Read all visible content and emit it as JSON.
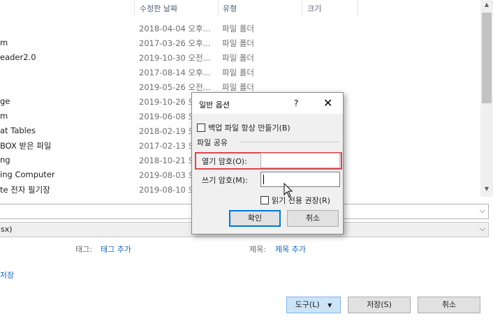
{
  "columns": {
    "date": "수정한 날짜",
    "type": "유형",
    "size": "크기"
  },
  "files": [
    {
      "name": "",
      "date": "2018-04-04 오후...",
      "type": "파일 폴더"
    },
    {
      "name": "m",
      "date": "2017-03-26 오후...",
      "type": "파일 폴더"
    },
    {
      "name": "eader2.0",
      "date": "2019-10-30 오전...",
      "type": "파일 폴더"
    },
    {
      "name": "",
      "date": "2017-08-14 오후...",
      "type": "파일 폴더"
    },
    {
      "name": "",
      "date": "2019-05-26 오전...",
      "type": "파일 폴더"
    },
    {
      "name": "ge",
      "date": "2019-10-26 오...",
      "type": ""
    },
    {
      "name": "m",
      "date": "2019-06-08 오...",
      "type": ""
    },
    {
      "name": "at Tables",
      "date": "2018-02-19 오...",
      "type": ""
    },
    {
      "name": "BOX 받은 파일",
      "date": "2017-02-13 오...",
      "type": ""
    },
    {
      "name": "ng",
      "date": "2018-10-21 오...",
      "type": ""
    },
    {
      "name": "ing Computer",
      "date": "2019-08-03 오...",
      "type": ""
    },
    {
      "name": "te 전자 필기장",
      "date": "2019-08-10 오...",
      "type": ""
    }
  ],
  "filename_field": {
    "value": ""
  },
  "filetype_field": {
    "value": "sx)"
  },
  "meta": {
    "tags_label": "태그:",
    "tags_link": "태그 추가",
    "title_label": "제목:",
    "title_link": "제목 추가"
  },
  "left_link": "저장",
  "buttons": {
    "tools": "도구(L)",
    "save": "저장(S)",
    "cancel": "취소"
  },
  "dialog": {
    "title": "일반 옵션",
    "help": "?",
    "close": "✕",
    "backup_label": "백업 파일 항상 만들기(B)",
    "backup_checked": false,
    "group_title": "파일 공유",
    "open_pw_label": "열기 암호(O):",
    "open_pw_value": "",
    "write_pw_label": "쓰기 암호(M):",
    "write_pw_value": "",
    "readonly_label": "읽기 전용 권장(R)",
    "readonly_checked": false,
    "ok": "확인",
    "cancel": "취소"
  },
  "colors": {
    "highlight": "#e0434b",
    "accent": "#0078d7",
    "link": "#1a66b5"
  }
}
